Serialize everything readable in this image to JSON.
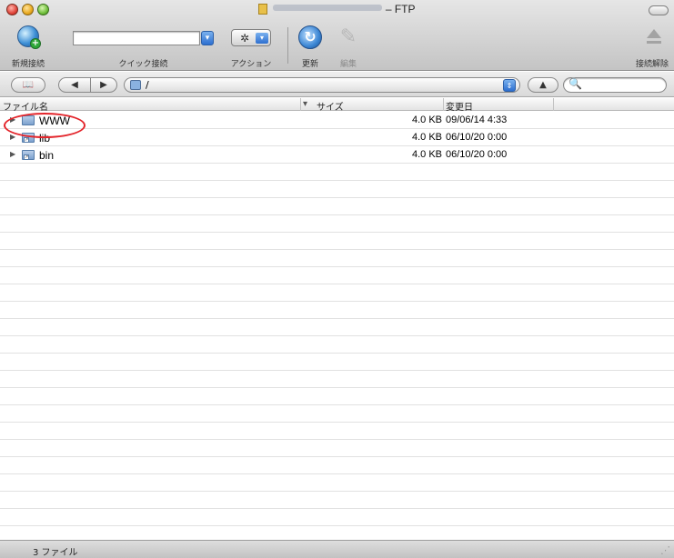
{
  "window": {
    "title_suffix": "– FTP"
  },
  "toolbar": {
    "new_connection_label": "新規接続",
    "quick_connect_label": "クイック接続",
    "action_label": "アクション",
    "refresh_label": "更新",
    "edit_label": "編集",
    "disconnect_label": "接続解除",
    "quick_connect_value": ""
  },
  "navbar": {
    "path": "/",
    "search_value": ""
  },
  "columns": {
    "name": "ファイル名",
    "size": "サイズ",
    "modified": "変更日"
  },
  "files": [
    {
      "name": "WWW",
      "size": "4.0 KB",
      "modified": "09/06/14 4:33",
      "icon": "folder-icon"
    },
    {
      "name": "lib",
      "size": "4.0 KB",
      "modified": "06/10/20 0:00",
      "icon": "folder-alias-icon"
    },
    {
      "name": "bin",
      "size": "4.0 KB",
      "modified": "06/10/20 0:00",
      "icon": "folder-alias-icon"
    }
  ],
  "status": {
    "file_count": "3 ファイル"
  },
  "colors": {
    "annotation": "#e3252b",
    "accent_blue": "#2d6fd0"
  }
}
